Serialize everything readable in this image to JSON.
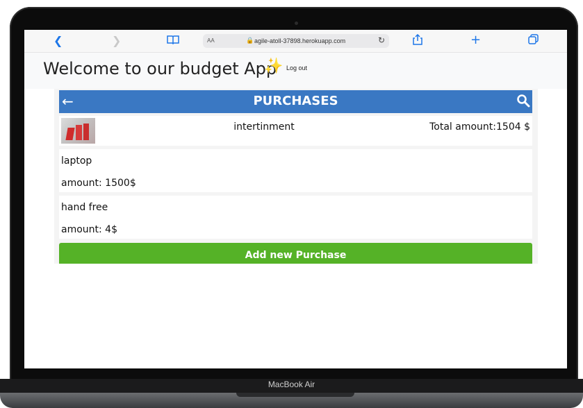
{
  "device": {
    "model_label": "MacBook Air"
  },
  "browser": {
    "text_size_label": "AA",
    "url": "agile-atoll-37898.herokuapp.com"
  },
  "header": {
    "title": "Welcome to our budget App",
    "logout_label": "Log out"
  },
  "purchases": {
    "title": "PURCHASES",
    "category_name": "intertinment",
    "total_amount": "Total amount:1504 $",
    "items": [
      {
        "name": "laptop",
        "amount": "amount: 1500$"
      },
      {
        "name": "hand free",
        "amount": "amount: 4$"
      }
    ],
    "add_button_label": "Add new Purchase"
  },
  "colors": {
    "header_bar": "#3a78c3",
    "add_button": "#55b227",
    "browser_accent": "#1d76e8"
  }
}
